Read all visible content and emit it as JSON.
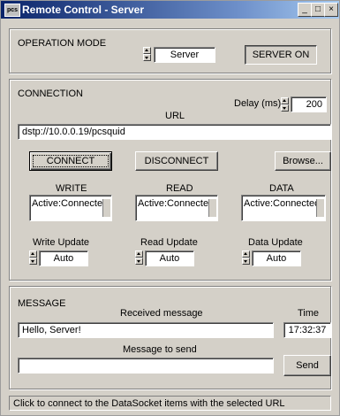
{
  "window": {
    "title": "Remote Control - Server",
    "icon_text": "pcs",
    "min_label": "_",
    "max_label": "□",
    "close_label": "×"
  },
  "operation": {
    "label": "OPERATION MODE",
    "mode_value": "Server",
    "server_button": "SERVER ON"
  },
  "connection": {
    "label": "CONNECTION",
    "delay_label": "Delay (ms)",
    "delay_value": "200",
    "url_label": "URL",
    "url_value": "dstp://10.0.0.19/pcsquid",
    "connect_button": "CONNECT",
    "disconnect_button": "DISCONNECT",
    "browse_button": "Browse...",
    "write_label": "WRITE",
    "read_label": "READ",
    "data_label": "DATA",
    "write_status": "Active:Connected",
    "read_status": "Active:Connected",
    "data_status": "Active:Connected",
    "write_update_label": "Write Update",
    "read_update_label": "Read Update",
    "data_update_label": "Data Update",
    "write_update_value": "Auto",
    "read_update_value": "Auto",
    "data_update_value": "Auto"
  },
  "message": {
    "label": "MESSAGE",
    "received_label": "Received message",
    "received_value": "Hello, Server!",
    "time_label": "Time",
    "time_value": "17:32:37",
    "send_label": "Message to send",
    "send_value": "",
    "send_button": "Send"
  },
  "status_bar": {
    "text": "Click to connect to the DataSocket items with the selected URL"
  }
}
